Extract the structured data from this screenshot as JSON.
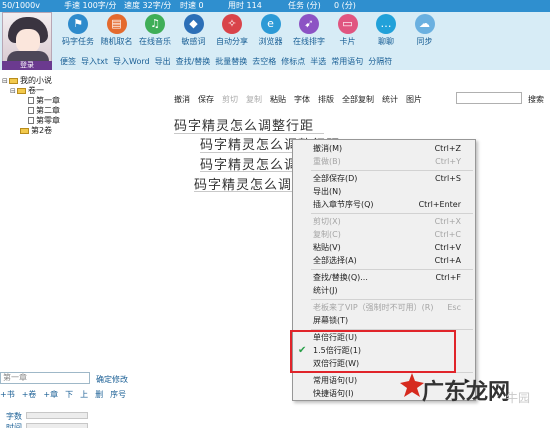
{
  "stats": {
    "a": "50/1000v",
    "b": "手速 100字/分",
    "c": "速度 32字/分",
    "d": "时速 0",
    "e": "用时 114",
    "f": "任务 (分)",
    "g": "0 (分)"
  },
  "avatar_label": "登录",
  "toolbar": [
    {
      "label": "码字任务",
      "icon": "flag-icon",
      "color": "#2e8bcc",
      "glyph": "⚑"
    },
    {
      "label": "随机取名",
      "icon": "book-icon",
      "color": "#e46a2e",
      "glyph": "▤"
    },
    {
      "label": "在线音乐",
      "icon": "music-icon",
      "color": "#3fae58",
      "glyph": "♫"
    },
    {
      "label": "敏感词",
      "icon": "shield-icon",
      "color": "#2c6fb7",
      "glyph": "◆"
    },
    {
      "label": "自动分享",
      "icon": "compass-icon",
      "color": "#d9434a",
      "glyph": "✧"
    },
    {
      "label": "浏览器",
      "icon": "browser-icon",
      "color": "#2c9ad6",
      "glyph": "e"
    },
    {
      "label": "在线排字",
      "icon": "rocket-icon",
      "color": "#8c53c4",
      "glyph": "➹"
    },
    {
      "label": "卡片",
      "icon": "card-icon",
      "color": "#e05580",
      "glyph": "▭"
    },
    {
      "label": "聊聊",
      "icon": "chat-icon",
      "color": "#21a1d9",
      "glyph": "…"
    },
    {
      "label": "同步",
      "icon": "cloud-icon",
      "color": "#6ab0e0",
      "glyph": "☁"
    }
  ],
  "links": [
    "便签",
    "导入txt",
    "导入Word",
    "导出",
    "查找/替换",
    "批量替换",
    "去空格",
    "修标点",
    "半选",
    "常用语句",
    "分隔符"
  ],
  "tree": {
    "root": "我的小说",
    "vol1": "卷一",
    "ch1": "第一章",
    "ch2": "第二章",
    "ch3": "第零章",
    "vol2": "第2卷"
  },
  "left_bottom": {
    "field": "第一章",
    "confirm": "确定修改",
    "actions": [
      "+书",
      "+卷",
      "+章",
      "下",
      "上",
      "删",
      "序号"
    ],
    "stat1": "字数",
    "stat2": "时间"
  },
  "editor_toolbar": [
    {
      "label": "撤消",
      "enabled": true
    },
    {
      "label": "保存",
      "enabled": true
    },
    {
      "label": "剪切",
      "enabled": false
    },
    {
      "label": "复制",
      "enabled": false
    },
    {
      "label": "粘贴",
      "enabled": true
    },
    {
      "label": "字体",
      "enabled": true
    },
    {
      "label": "排版",
      "enabled": true
    },
    {
      "label": "全部复制",
      "enabled": true
    },
    {
      "label": "统计",
      "enabled": true
    },
    {
      "label": "图片",
      "enabled": true
    }
  ],
  "search_label": "搜索",
  "editor_lines": [
    "码字精灵怎么调整行距",
    "码字精灵怎么调整行距",
    "码字精灵怎么调整行距",
    "码字精灵怎么调整行距"
  ],
  "context_menu": [
    {
      "label": "撤消(M)",
      "shortcut": "Ctrl+Z",
      "enabled": true
    },
    {
      "label": "重做(B)",
      "shortcut": "Ctrl+Y",
      "enabled": false
    },
    {
      "label": "全部保存(D)",
      "shortcut": "Ctrl+S",
      "enabled": true
    },
    {
      "label": "导出(N)",
      "shortcut": "",
      "enabled": true
    },
    {
      "label": "插入章节序号(Q)",
      "shortcut": "Ctrl+Enter",
      "enabled": true
    },
    {
      "label": "剪切(X)",
      "shortcut": "Ctrl+X",
      "enabled": false
    },
    {
      "label": "复制(C)",
      "shortcut": "Ctrl+C",
      "enabled": false
    },
    {
      "label": "粘贴(V)",
      "shortcut": "Ctrl+V",
      "enabled": true
    },
    {
      "label": "全部选择(A)",
      "shortcut": "Ctrl+A",
      "enabled": true
    },
    {
      "label": "查找/替换(Q)...",
      "shortcut": "Ctrl+F",
      "enabled": true
    },
    {
      "label": "统计(J)",
      "shortcut": "",
      "enabled": true
    },
    {
      "label": "老板来了VIP（强制时不可用）(R)",
      "shortcut": "Esc",
      "enabled": false
    },
    {
      "label": "屏幕锁(T)",
      "shortcut": "",
      "enabled": true
    },
    {
      "label": "单倍行距(U)",
      "shortcut": "",
      "enabled": true
    },
    {
      "label": "1.5倍行距(1)",
      "shortcut": "",
      "enabled": true,
      "checked": true
    },
    {
      "label": "双倍行距(W)",
      "shortcut": "",
      "enabled": true
    },
    {
      "label": "常用语句(U)",
      "shortcut": "",
      "enabled": true,
      "submenu": true
    },
    {
      "label": "快捷语句(I)",
      "shortcut": "",
      "enabled": true
    }
  ],
  "watermark": {
    "big": "广东龙网",
    "small": "牛园"
  }
}
